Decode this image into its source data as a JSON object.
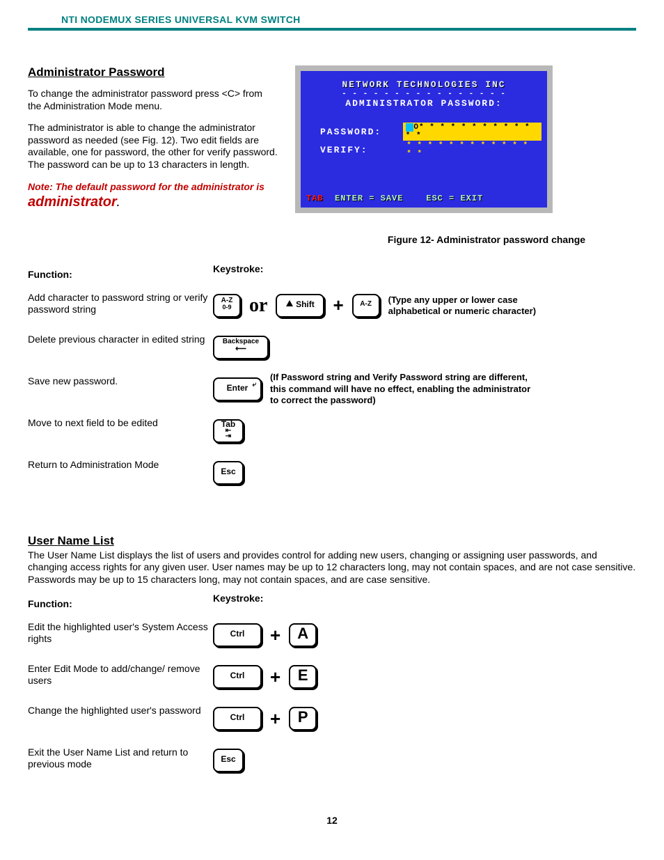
{
  "header": "NTI NODEMUX SERIES UNIVERSAL KVM SWITCH",
  "section1": {
    "title": "Administrator Password",
    "p1": "To change the administrator password press <C> from the Administration Mode menu.",
    "p2": "The administrator is able to change the administrator password as needed (see Fig. 12).   Two edit fields are available, one for password, the other for verify password.  The password can be up to 13 characters in length.",
    "note_prefix": "Note:  The default password for the administrator is ",
    "note_word": "administrator",
    "note_dot": "."
  },
  "screenshot": {
    "title": "NETWORK  TECHNOLOGIES  INC",
    "dashes": "- - - - - - - - - - - - - - - -",
    "subtitle": "ADMINISTRATOR  PASSWORD:",
    "row1_label": "PASSWORD:",
    "row1_value": "O* * * * * * * * * * * * *",
    "row2_label": "VERIFY:",
    "row2_value": "* * * * * * * * * * * * * *",
    "footer_tab": "TAB",
    "footer_save": "ENTER  =  SAVE",
    "footer_esc": "ESC  =  EXIT"
  },
  "fig_caption": "Figure 12- Administrator password change",
  "fk_headings": {
    "f": "Function:",
    "k": "Keystroke:"
  },
  "s1_functions": {
    "f1": "Add character to password string or verify password string",
    "f2": "Delete previous character in edited string",
    "f3": "Save new password.",
    "f4": "Move to next field to be edited",
    "f5": "Return to Administration Mode"
  },
  "keys": {
    "az09_top": "A-Z",
    "az09_bot": "0-9",
    "az": "A-Z",
    "or": "or",
    "shift": "Shift",
    "plus": "+",
    "backspace": "Backspace",
    "enter": "Enter",
    "tab": "Tab",
    "esc": "Esc",
    "ctrl": "Ctrl",
    "A": "A",
    "E": "E",
    "P": "P"
  },
  "s1_notes": {
    "n1": "(Type any upper or lower case alphabetical or numeric character)",
    "n3": "(If Password string and Verify Password string are different,  this command will have no effect, enabling the administrator to correct the password)"
  },
  "section2": {
    "title": "User Name List",
    "desc": "The User Name List displays the list of users and provides control for adding new users, changing or assigning user passwords, and changing access rights for any given user.  User names may be up to 12 characters long, may not contain spaces, and are not case sensitive.  Passwords may be up to 15 characters long, may not contain spaces, and are case sensitive.",
    "f1": "Edit the highlighted user's System Access rights",
    "f2": "Enter Edit Mode to add/change/ remove users",
    "f3": "Change the highlighted user's password",
    "f4": "Exit the User Name List and return to previous mode"
  },
  "pageno": "12"
}
